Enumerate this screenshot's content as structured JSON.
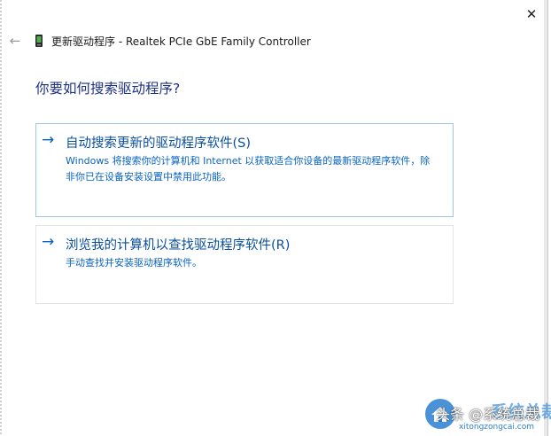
{
  "window": {
    "close_glyph": "✕",
    "back_glyph": "←",
    "title": "更新驱动程序 - Realtek PCIe GbE Family Controller"
  },
  "question": "你要如何搜索驱动程序?",
  "options": [
    {
      "arrow": "→",
      "title": "自动搜索更新的驱动程序软件(S)",
      "description": "Windows 将搜索你的计算机和 Internet 以获取适合你设备的最新驱动程序软件，除非你已在设备安装设置中禁用此功能。"
    },
    {
      "arrow": "→",
      "title": "浏览我的计算机以查找驱动程序软件(R)",
      "description": "手动查找并安装驱动程序软件。"
    }
  ],
  "watermark": {
    "text": "头条 @系统总裁",
    "brand": "系统总裁",
    "url": "xitongzongcai.com"
  },
  "colors": {
    "heading": "#1e3287",
    "link": "#0a64c2",
    "selected_border": "#9fc5e8"
  },
  "icons": {
    "close": "close-icon",
    "back": "back-arrow-icon",
    "device": "network-adapter-icon",
    "option_arrow": "arrow-right-icon"
  }
}
